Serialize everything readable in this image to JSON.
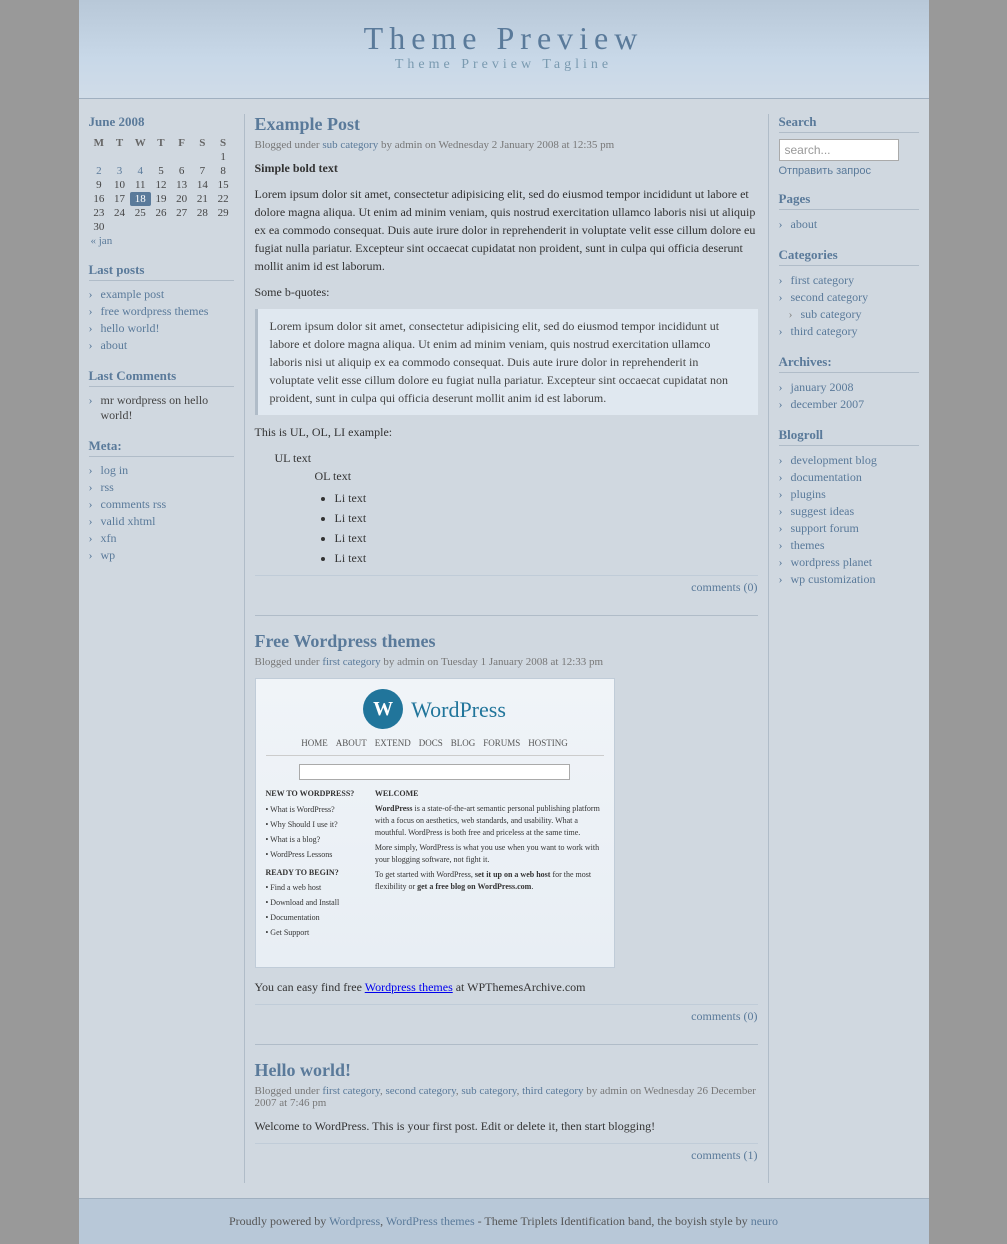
{
  "header": {
    "title": "Theme Preview",
    "tagline": "Theme Preview Tagline"
  },
  "sidebar_left": {
    "calendar": {
      "month": "June 2008",
      "days_header": [
        "M",
        "T",
        "W",
        "T",
        "F",
        "S",
        "S"
      ],
      "rows": [
        [
          "",
          "",
          "",
          "",
          "",
          "",
          "1"
        ],
        [
          "2",
          "3",
          "4",
          "5",
          "6",
          "7",
          "8"
        ],
        [
          "9",
          "10",
          "11",
          "12",
          "13",
          "14",
          "15"
        ],
        [
          "16",
          "17",
          "18",
          "19",
          "20",
          "21",
          "22"
        ],
        [
          "23",
          "24",
          "25",
          "26",
          "27",
          "28",
          "29"
        ],
        [
          "30",
          "",
          "",
          "",
          "",
          "",
          ""
        ]
      ],
      "today": "18",
      "nav_prev": "« jan"
    },
    "last_posts_title": "Last posts",
    "last_posts": [
      {
        "label": "example post",
        "href": "#"
      },
      {
        "label": "free wordpress themes",
        "href": "#"
      },
      {
        "label": "hello world!",
        "href": "#"
      },
      {
        "label": "about",
        "href": "#"
      }
    ],
    "last_comments_title": "Last Comments",
    "last_comments": [
      {
        "label": "mr wordpress on hello world!"
      }
    ],
    "meta_title": "Meta:",
    "meta_items": [
      {
        "label": "log in",
        "href": "#"
      },
      {
        "label": "rss",
        "href": "#"
      },
      {
        "label": "comments rss",
        "href": "#"
      },
      {
        "label": "valid xhtml",
        "href": "#"
      },
      {
        "label": "xfn",
        "href": "#"
      },
      {
        "label": "wp",
        "href": "#"
      }
    ]
  },
  "posts": [
    {
      "id": "example-post",
      "title": "Example Post",
      "meta": "Blogged under sub category by admin on Wednesday 2 January 2008 at 12:35 pm",
      "meta_link": "sub category",
      "bold_intro": "Simple bold text",
      "paragraphs": [
        "Lorem ipsum dolor sit amet, consectetur adipisicing elit, sed do eiusmod tempor incididunt ut labore et dolore magna aliqua. Ut enim ad minim veniam, quis nostrud exercitation ullamco laboris nisi ut aliquip ex ea commodo consequat. Duis aute irure dolor in reprehenderit in voluptate velit esse cillum dolore eu fugiat nulla pariatur. Excepteur sint occaecat cupidatat non proident, sunt in culpa qui officia deserunt mollit anim id est laborum."
      ],
      "bquote_label": "Some b-quotes:",
      "blockquote": "Lorem ipsum dolor sit amet, consectetur adipisicing elit, sed do eiusmod tempor incididunt ut labore et dolore magna aliqua. Ut enim ad minim veniam, quis nostrud exercitation ullamco laboris nisi ut aliquip ex ea commodo consequat. Duis aute irure dolor in reprehenderit in voluptate velit esse cillum dolore eu fugiat nulla pariatur. Excepteur sint occaecat cupidatat non proident, sunt in culpa qui officia deserunt mollit anim id est laborum.",
      "ul_label": "This is UL, OL, LI example:",
      "ul_text": "UL text",
      "ol_text": "OL text",
      "li_items": [
        "Li text",
        "Li text",
        "Li text",
        "Li text"
      ],
      "comments": "comments (0)"
    },
    {
      "id": "free-wordpress-themes",
      "title": "Free Wordpress themes",
      "meta": "Blogged under first category by admin on Tuesday 1 January 2008 at 12:33 pm",
      "meta_link": "first category",
      "body_text_1": "You can easy find free",
      "body_link": "Wordpress themes",
      "body_link_href": "#",
      "body_text_2": "at WPThemesArchive.com",
      "comments": "comments (0)"
    },
    {
      "id": "hello-world",
      "title": "Hello world!",
      "meta": "Blogged under first category, second category, sub category, third category by admin on Wednesday 26 December 2007 at 7:46 pm",
      "meta_links": [
        "first category",
        "second category",
        "sub category",
        "third category"
      ],
      "body": "Welcome to WordPress. This is your first post. Edit or delete it, then start blogging!",
      "comments": "comments (1)"
    }
  ],
  "sidebar_right": {
    "search_title": "Search",
    "search_placeholder": "search...",
    "search_button": "Отправить запрос",
    "pages_title": "Pages",
    "pages": [
      {
        "label": "about",
        "href": "#"
      }
    ],
    "categories_title": "Categories",
    "categories": [
      {
        "label": "first category",
        "href": "#",
        "sub": false
      },
      {
        "label": "second category",
        "href": "#",
        "sub": false
      },
      {
        "label": "sub category",
        "href": "#",
        "sub": true
      },
      {
        "label": "third category",
        "href": "#",
        "sub": false
      }
    ],
    "archives_title": "Archives:",
    "archives": [
      {
        "label": "january 2008",
        "href": "#"
      },
      {
        "label": "december 2007",
        "href": "#"
      }
    ],
    "blogroll_title": "Blogroll",
    "blogroll": [
      {
        "label": "development blog",
        "href": "#"
      },
      {
        "label": "documentation",
        "href": "#"
      },
      {
        "label": "plugins",
        "href": "#"
      },
      {
        "label": "suggest ideas",
        "href": "#"
      },
      {
        "label": "support forum",
        "href": "#"
      },
      {
        "label": "themes",
        "href": "#"
      },
      {
        "label": "wordpress planet",
        "href": "#"
      },
      {
        "label": "wp customization",
        "href": "#"
      }
    ]
  },
  "footer": {
    "text": "Proudly powered by",
    "wordpress_link": "Wordpress",
    "wp_themes_link": "WordPress themes",
    "rest": "- Theme Triplets Identification band, the boyish style by",
    "neuro_link": "neuro"
  }
}
